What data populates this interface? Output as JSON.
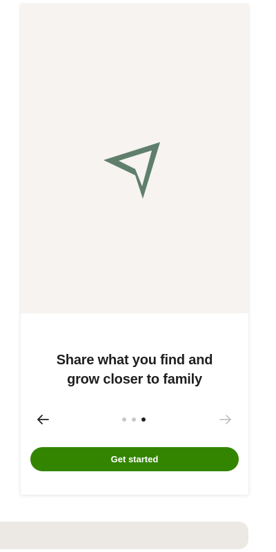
{
  "onboarding": {
    "headline_line1": "Share what you find and",
    "headline_line2": "grow closer to family",
    "cta_label": "Get started",
    "prev_icon": "arrow-left-icon",
    "next_icon": "arrow-right-icon",
    "hero_icon": "navigation-arrow-icon",
    "pagination": {
      "total": 3,
      "current": 3
    }
  },
  "colors": {
    "hero_background": "#f6f3f0",
    "hero_icon": "#5f7f6c",
    "cta_background": "#338500",
    "cta_text": "#ffffff",
    "headline_text": "#1f1f1f",
    "dot_active": "#1f1f1f",
    "dot_inactive": "#c8c8c8",
    "footer_bar": "#ece9e4"
  }
}
